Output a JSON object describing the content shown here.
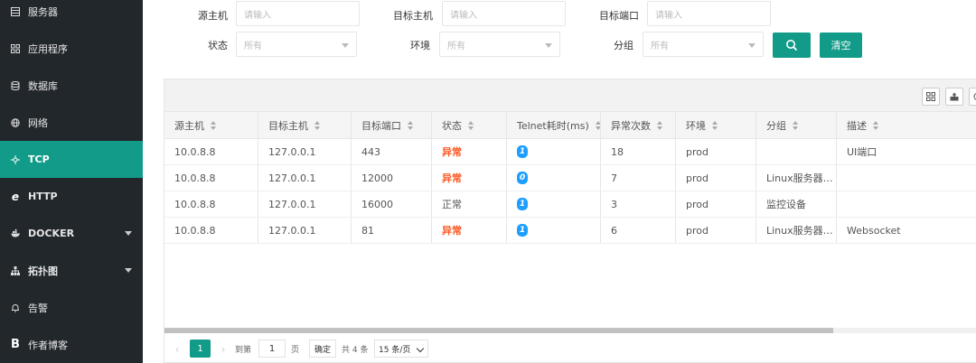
{
  "sidebar": {
    "items": [
      {
        "label": "服务器",
        "icon": "server-icon"
      },
      {
        "label": "应用程序",
        "icon": "app-icon"
      },
      {
        "label": "数据库",
        "icon": "database-icon"
      },
      {
        "label": "网络",
        "icon": "network-icon"
      },
      {
        "label": "TCP",
        "icon": "tcp-icon"
      },
      {
        "label": "HTTP",
        "icon": "http-icon"
      },
      {
        "label": "DOCKER",
        "icon": "docker-icon"
      },
      {
        "label": "拓扑图",
        "icon": "topology-icon"
      },
      {
        "label": "告警",
        "icon": "bell-icon"
      },
      {
        "label": "作者博客",
        "icon": "blog-icon"
      }
    ],
    "active": "TCP"
  },
  "filters": {
    "source_host_label": "源主机",
    "source_host_placeholder": "请输入",
    "target_host_label": "目标主机",
    "target_host_placeholder": "请输入",
    "target_port_label": "目标端口",
    "target_port_placeholder": "请输入",
    "status_label": "状态",
    "status_value": "所有",
    "env_label": "环境",
    "env_value": "所有",
    "group_label": "分组",
    "group_value": "所有",
    "clear_label": "清空"
  },
  "table": {
    "columns": [
      "源主机",
      "目标主机",
      "目标端口",
      "状态",
      "Telnet耗时(ms)",
      "异常次数",
      "环境",
      "分组",
      "描述"
    ],
    "rows": [
      {
        "source": "10.0.8.8",
        "target": "127.0.0.1",
        "port": "443",
        "status": "异常",
        "telnet": "1",
        "errors": "18",
        "env": "prod",
        "group": "",
        "desc": "UI端口"
      },
      {
        "source": "10.0.8.8",
        "target": "127.0.0.1",
        "port": "12000",
        "status": "异常",
        "telnet": "0",
        "errors": "7",
        "env": "prod",
        "group": "Linux服务器…",
        "desc": ""
      },
      {
        "source": "10.0.8.8",
        "target": "127.0.0.1",
        "port": "16000",
        "status": "正常",
        "telnet": "1",
        "errors": "3",
        "env": "prod",
        "group": "监控设备",
        "desc": ""
      },
      {
        "source": "10.0.8.8",
        "target": "127.0.0.1",
        "port": "81",
        "status": "异常",
        "telnet": "1",
        "errors": "6",
        "env": "prod",
        "group": "Linux服务器…",
        "desc": "Websocket"
      }
    ]
  },
  "pager": {
    "current": "1",
    "goto_label": "到第",
    "goto_value": "1",
    "page_label": "页",
    "confirm_label": "确定",
    "total_label": "共 4 条",
    "page_size": "15 条/页"
  },
  "colors": {
    "accent": "#129b88",
    "sidebar_bg": "#22272c",
    "error": "#ff5722",
    "badge": "#1e9fff"
  }
}
